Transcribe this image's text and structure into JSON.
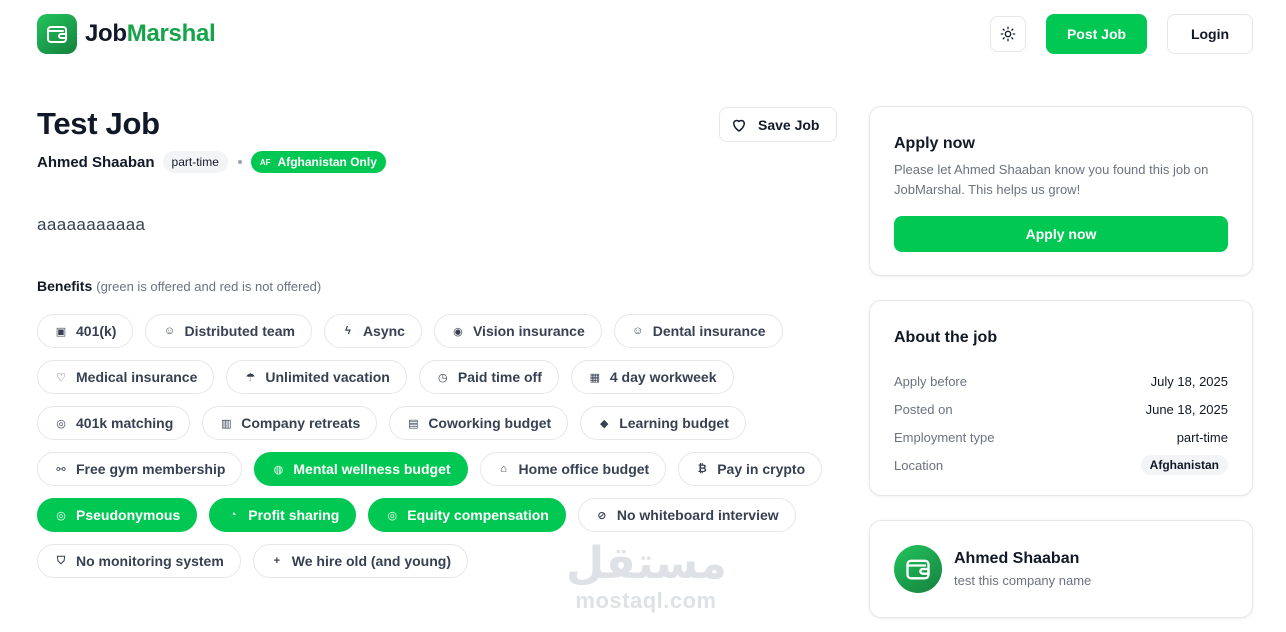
{
  "header": {
    "logo_part1": "Job",
    "logo_part2": "Marshal",
    "post_job_label": "Post Job",
    "login_label": "Login",
    "theme_icon": "sun-icon"
  },
  "job": {
    "title": "Test Job",
    "save_label": "Save Job",
    "company": "Ahmed Shaaban",
    "type": "part-time",
    "country_code": "AF",
    "country_label": "Afghanistan Only",
    "description": "aaaaaaaaaaa"
  },
  "benefits": {
    "heading": "Benefits",
    "note": "(green is offered and red is not offered)",
    "items": [
      {
        "label": "401(k)",
        "icon": "briefcase-icon",
        "offered": false
      },
      {
        "label": "Distributed team",
        "icon": "users-icon",
        "offered": false
      },
      {
        "label": "Async",
        "icon": "bolt-icon",
        "offered": false
      },
      {
        "label": "Vision insurance",
        "icon": "eye-icon",
        "offered": false
      },
      {
        "label": "Dental insurance",
        "icon": "smile-icon",
        "offered": false
      },
      {
        "label": "Medical insurance",
        "icon": "heart-icon",
        "offered": false
      },
      {
        "label": "Unlimited vacation",
        "icon": "umbrella-icon",
        "offered": false
      },
      {
        "label": "Paid time off",
        "icon": "clock-icon",
        "offered": false
      },
      {
        "label": "4 day workweek",
        "icon": "calendar-icon",
        "offered": false
      },
      {
        "label": "401k matching",
        "icon": "coins-icon",
        "offered": false
      },
      {
        "label": "Company retreats",
        "icon": "building-icon",
        "offered": false
      },
      {
        "label": "Coworking budget",
        "icon": "office-icon",
        "offered": false
      },
      {
        "label": "Learning budget",
        "icon": "graduation-cap-icon",
        "offered": false
      },
      {
        "label": "Free gym membership",
        "icon": "dumbbell-icon",
        "offered": false
      },
      {
        "label": "Mental wellness budget",
        "icon": "brain-icon",
        "offered": true
      },
      {
        "label": "Home office budget",
        "icon": "home-icon",
        "offered": false
      },
      {
        "label": "Pay in crypto",
        "icon": "bitcoin-icon",
        "offered": false
      },
      {
        "label": "Pseudonymous",
        "icon": "user-circle-icon",
        "offered": true
      },
      {
        "label": "Profit sharing",
        "icon": "pie-chart-icon",
        "offered": true
      },
      {
        "label": "Equity compensation",
        "icon": "coins-icon",
        "offered": true
      },
      {
        "label": "No whiteboard interview",
        "icon": "no-presentation-icon",
        "offered": false
      },
      {
        "label": "No monitoring system",
        "icon": "shield-icon",
        "offered": false
      },
      {
        "label": "We hire old (and young)",
        "icon": "user-plus-icon",
        "offered": false
      }
    ]
  },
  "apply": {
    "title": "Apply now",
    "text": "Please let Ahmed Shaaban know you found this job on JobMarshal. This helps us grow!",
    "button": "Apply now"
  },
  "about": {
    "title": "About the job",
    "rows": [
      {
        "label": "Apply before",
        "value": "July 18, 2025"
      },
      {
        "label": "Posted on",
        "value": "June 18, 2025"
      },
      {
        "label": "Employment type",
        "value": "part-time"
      },
      {
        "label": "Location",
        "value": "Afghanistan"
      }
    ]
  },
  "company_card": {
    "name": "Ahmed Shaaban",
    "subtitle": "test this company name"
  },
  "watermark": {
    "arabic": "مستقل",
    "latin": "mostaql.com"
  },
  "colors": {
    "accent": "#00c853",
    "brand_text": "#16a34a"
  }
}
